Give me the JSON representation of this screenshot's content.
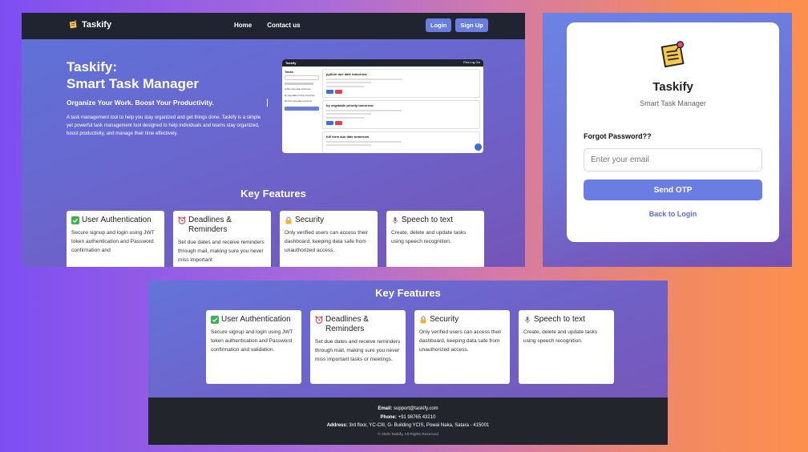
{
  "landing": {
    "brand": "Taskify",
    "nav": {
      "home": "Home",
      "contact": "Contact us",
      "login": "Login",
      "signup": "Sign Up"
    },
    "hero": {
      "title_line1": "Taskify:",
      "title_line2": "Smart Task Manager",
      "subtitle": "Organize Your Work. Boost Your Productivity.",
      "description": "A task management tool to help you stay organized and get things done. Taskify is a simple yet powerful task management tool designed to help individuals and teams stay organized, boost productivity, and manage their time effectively."
    },
    "preview": {
      "app_title": "Taskify",
      "top_right": "Files   Log Out",
      "sidebar_title": "Tasks",
      "sidebar_tasks": [
        "python due date tomorrow",
        "by vegetable priority tomorrow",
        "full form due date tomorrow"
      ],
      "tasks": [
        {
          "title": "python due date tomorrow"
        },
        {
          "title": "by vegetable priority tomorrow"
        },
        {
          "title": "full form due date tomorrow"
        }
      ]
    },
    "features_title": "Key Features",
    "features": [
      {
        "icon": "check-icon",
        "title": "User Authentication",
        "desc": "Secure signup and login using JWT token authentication and Password confirmation and"
      },
      {
        "icon": "alarm-clock-icon",
        "title": "Deadlines & Reminders",
        "desc": "Set due dates and receive reminders through mail, making sure you never miss important"
      },
      {
        "icon": "lock-icon",
        "title": "Security",
        "desc": "Only verified users can access their dashboard, keeping data safe from unauthorized access."
      },
      {
        "icon": "microphone-icon",
        "title": "Speech to text",
        "desc": "Create, delete and update tasks using speech recognition."
      }
    ]
  },
  "forgot": {
    "app_name": "Taskify",
    "tagline": "Smart Task Manager",
    "label": "Forgot Password??",
    "email_placeholder": "Enter your email",
    "email_value": "",
    "send_button": "Send OTP",
    "back_link": "Back to Login"
  },
  "features_page": {
    "title": "Key Features",
    "features": [
      {
        "icon": "check-icon",
        "title": "User Authentication",
        "desc": "Secure signup and login using JWT token authentication and Password confirmation and validation."
      },
      {
        "icon": "alarm-clock-icon",
        "title": "Deadlines & Reminders",
        "desc": "Set due dates and receive reminders through mail, making sure you never miss important tasks or meetings."
      },
      {
        "icon": "lock-icon",
        "title": "Security",
        "desc": "Only verified users can access their dashboard, keeping data safe from unauthorized access."
      },
      {
        "icon": "microphone-icon",
        "title": "Speech to text",
        "desc": "Create, delete and update tasks using speech recognition."
      }
    ],
    "footer": {
      "email_label": "Email:",
      "email": "support@taskify.com",
      "phone_label": "Phone:",
      "phone": "+91 98765 43210",
      "address_label": "Address:",
      "address": "3rd floor, YC-CIII, G- Building YCIS, Powai Naka, Satara - 415001",
      "copyright": "© 2025 Taskify. All Rights Reserved"
    }
  },
  "colors": {
    "navbar": "#1f2430",
    "accent": "#6a7de2",
    "link": "#5b6ed6",
    "footer": "#22252b"
  }
}
